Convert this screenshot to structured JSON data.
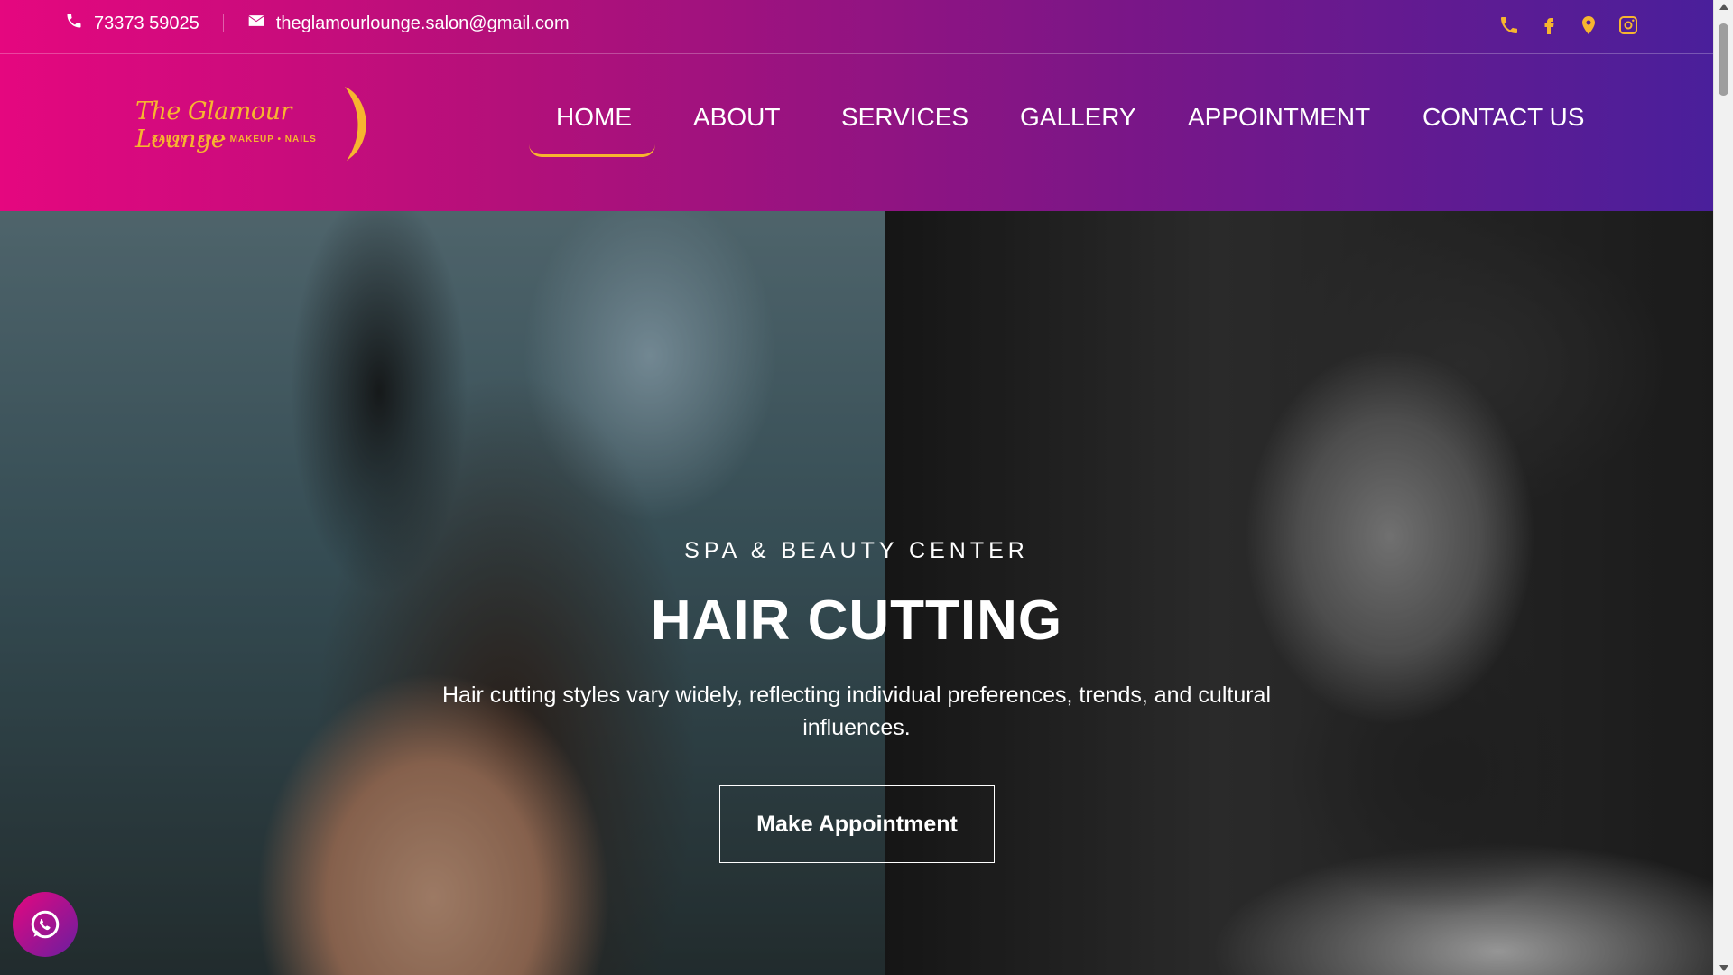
{
  "topbar": {
    "phone": "73373 59025",
    "email": "theglamourlounge.salon@gmail.com"
  },
  "social": {
    "icons": [
      "phone-icon",
      "facebook-icon",
      "location-pin-icon",
      "instagram-icon"
    ]
  },
  "logo": {
    "title": "The Glamour Lounge",
    "tagline": "SALON • SPA • MAKEUP • NAILS"
  },
  "nav": {
    "items": [
      "HOME",
      "ABOUT",
      "SERVICES",
      "GALLERY",
      "APPOINTMENT",
      "CONTACT US"
    ],
    "active": "HOME"
  },
  "hero": {
    "subtitle": "SPA & BEAUTY CENTER",
    "title": "HAIR CUTTING",
    "description": "Hair cutting styles vary widely, reflecting individual preferences, trends, and cultural influences.",
    "button_label": "Make Appointment"
  },
  "colors": {
    "gradient_start": "#e5077f",
    "gradient_end": "#4a1f9b",
    "accent_gold": "#f7b52f"
  }
}
